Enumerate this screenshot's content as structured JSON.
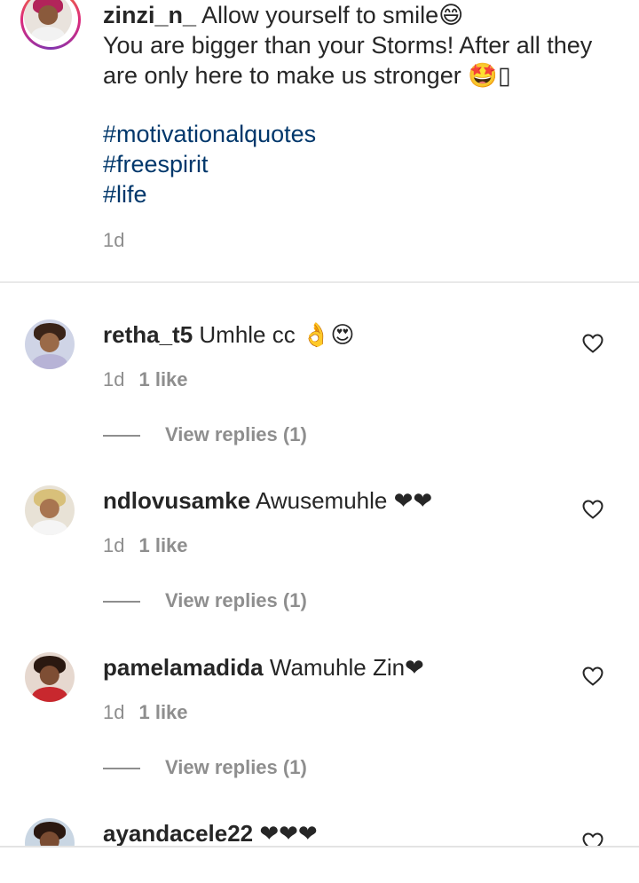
{
  "caption": {
    "username": "zinzi_n_",
    "text_line1": " Allow yourself to smile😄",
    "text_rest": "You are bigger than your Storms! After all they are only here to make us stronger 🤩▯",
    "hashtags": [
      "#motivationalquotes",
      "#freespirit",
      "#life"
    ],
    "time": "1d"
  },
  "comments": [
    {
      "username": "retha_t5",
      "text": " Umhle cc 👌😍",
      "time": "1d",
      "likes": "1 like",
      "replies": "View replies (1)"
    },
    {
      "username": "ndlovusamke",
      "text": " Awusemuhle ❤❤",
      "time": "1d",
      "likes": "1 like",
      "replies": "View replies (1)"
    },
    {
      "username": "pamelamadida",
      "text": " Wamuhle Zin❤",
      "time": "1d",
      "likes": "1 like",
      "replies": "View replies (1)"
    },
    {
      "username": "ayandacele22",
      "text": " ❤❤❤"
    }
  ],
  "colors": {
    "text": "#262626",
    "secondary": "#8e8e8e",
    "hashtag": "#00376b",
    "heart_emoji": "#e0103a"
  },
  "icons": [
    "heart-outline-icon"
  ]
}
